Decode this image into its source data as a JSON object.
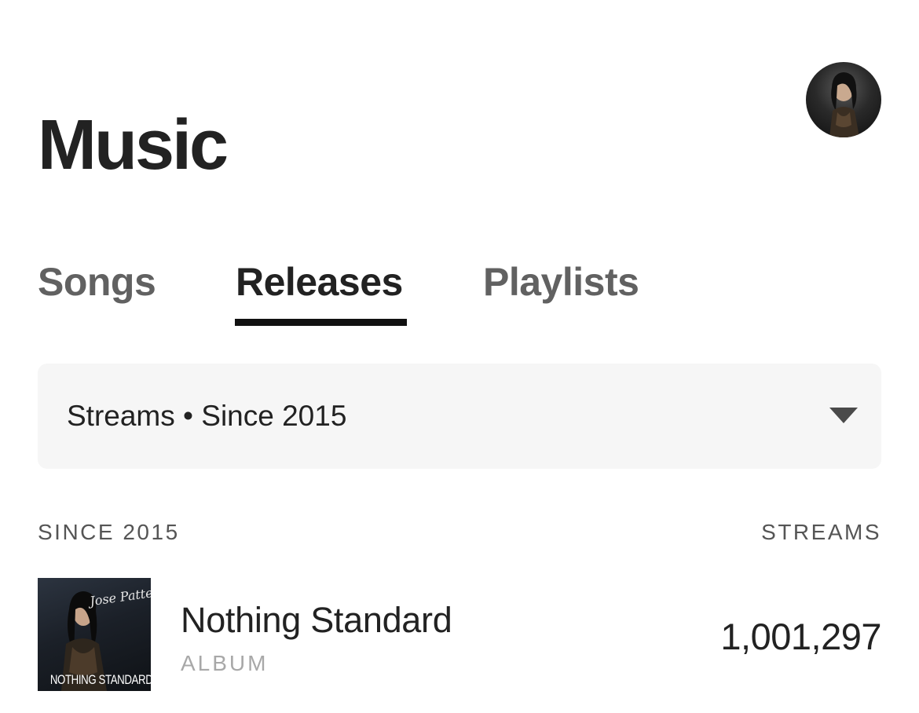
{
  "header": {
    "title": "Music",
    "avatar_icon": "profile-avatar"
  },
  "tabs": [
    {
      "label": "Songs",
      "active": false
    },
    {
      "label": "Releases",
      "active": true
    },
    {
      "label": "Playlists",
      "active": false
    }
  ],
  "filter": {
    "label": "Streams • Since 2015",
    "icon": "caret-down-icon"
  },
  "list": {
    "left_header": "SINCE 2015",
    "right_header": "STREAMS",
    "items": [
      {
        "title": "Nothing Standard",
        "type": "ALBUM",
        "streams": "1,001,297",
        "cover_text": "NOTHING STANDARD",
        "cover_signature": "Jose Patten"
      }
    ]
  },
  "colors": {
    "active_tab": "#222222",
    "inactive_tab": "#616161",
    "tab_underline": "#111111",
    "filter_bg": "#f6f6f6",
    "muted_text": "#a8a8a8"
  }
}
